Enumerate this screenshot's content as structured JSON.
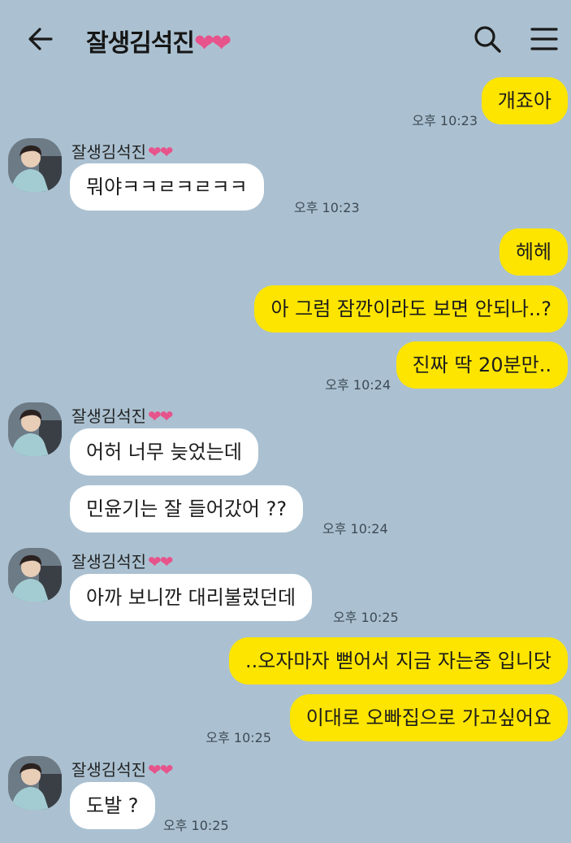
{
  "header": {
    "title": "잘생김석진",
    "title_hearts": "❤❤",
    "back_icon": "arrow-left-icon",
    "search_icon": "search-icon",
    "menu_icon": "hamburger-menu-icon"
  },
  "colors": {
    "background": "#abc1d1",
    "outgoing_bubble": "#fee500",
    "incoming_bubble": "#ffffff",
    "heart": "#e7538b"
  },
  "sender": {
    "name": "잘생김석진",
    "hearts": "❤❤"
  },
  "messages": [
    {
      "direction": "out",
      "text": "개죠아",
      "time": "오후 10:23"
    },
    {
      "direction": "in",
      "text": "뭐야ㅋㅋㄹㅋㄹㅋㅋ",
      "time": "오후 10:23"
    },
    {
      "direction": "out",
      "text": "헤헤",
      "time": ""
    },
    {
      "direction": "out",
      "text": "아 그럼 잠깐이라도 보면 안되나..?",
      "time": ""
    },
    {
      "direction": "out",
      "text": "진짜 딱 20분만..",
      "time": "오후 10:24"
    },
    {
      "direction": "in",
      "text": "어허 너무 늦었는데",
      "time": ""
    },
    {
      "direction": "in",
      "text": "민윤기는 잘 들어갔어 ??",
      "time": "오후 10:24"
    },
    {
      "direction": "in",
      "text": "아까 보니깐 대리불렀던데",
      "time": "오후 10:25"
    },
    {
      "direction": "out",
      "text": "..오자마자 뻗어서 지금 자는중 입니닷",
      "time": ""
    },
    {
      "direction": "out",
      "text": "이대로 오빠집으로 가고싶어요",
      "time": "오후 10:25"
    },
    {
      "direction": "in",
      "text": "도발 ?",
      "time": "오후 10:25"
    }
  ]
}
